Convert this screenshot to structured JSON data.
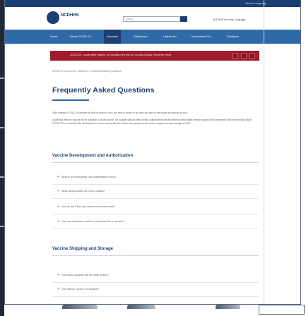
{
  "top_bar": {
    "language_label": "Select Language"
  },
  "header": {
    "logo_text": "NCDHHS",
    "search_placeholder": "Search",
    "links": "NCDHHS   Get Help   Language"
  },
  "nav": {
    "items": [
      "Home",
      "About COVID-19",
      "Vaccines",
      "Dashboard",
      "Latest Info",
      "Information For",
      "Guidance"
    ]
  },
  "alert": {
    "text": "COVID-19: County Alert System: 44 Counties Red and 24 Counties Orange. Read the report."
  },
  "breadcrumb": "NCDHHS COVID-19  >  Vaccines  >  Frequently Asked Questions",
  "page_title": "Frequently Asked Questions",
  "intro": {
    "line1": "Safe, effective COVID-19 vaccines will help us slow the virus, get back in control of our lives and back to the people and places we love.",
    "line2": "A safe and effective vaccine will be available to all who want it, but supplies will be limited at first. Independent state and federal public health advisory groups have determined that the best way to fight COVID-19 is to start first with vaccinations for those most at risk, then reach more people as the vaccine supply increases throughout 2021."
  },
  "sections": [
    {
      "heading": "Vaccine Development and Authorization",
      "questions": [
        "What is an Emergency Use Authorization (EUA)?",
        "What happens after an EUA is issued?",
        "How do the Pfizer and Moderna vaccines work?",
        "How can someone enroll in a clinical trial for a vaccine?"
      ]
    },
    {
      "heading": "Vaccine Shipping and Storage",
      "questions": [
        "How many vaccines will the state receive?",
        "How will the vaccine be shipped?"
      ]
    }
  ],
  "icons": {
    "accordion": "plus-icon",
    "search": "search-icon",
    "logo": "ncdhhs-seal-icon"
  },
  "colors": {
    "brand": "#1c3f73",
    "nav": "#2e6aa8",
    "alert": "#a01c2a"
  }
}
